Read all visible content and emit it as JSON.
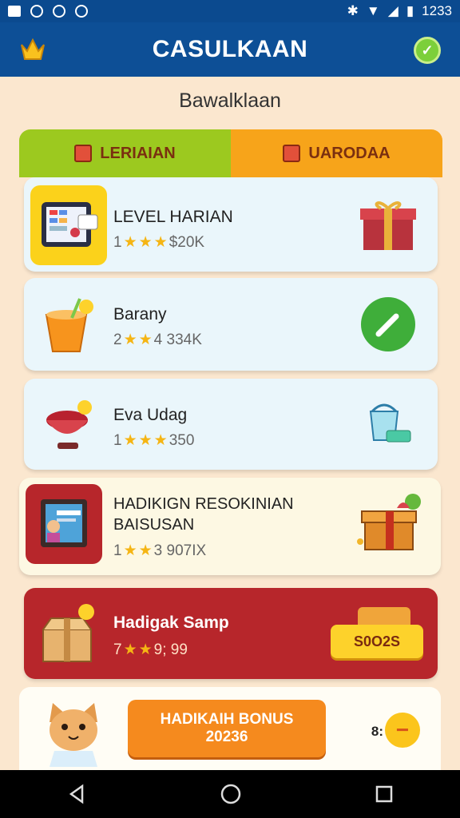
{
  "status_bar": {
    "time": "1233"
  },
  "app_bar": {
    "title": "CASULKAAN",
    "left_icon": "crown-icon",
    "right_icon": "check-badge-icon"
  },
  "subtitle": "Bawalklaan",
  "tabs": [
    {
      "label": "LERIAIAN",
      "icon": "gift-box-icon",
      "color": "#9cc91f"
    },
    {
      "label": "UARODAA",
      "icon": "basket-icon",
      "color": "#f7a41a"
    }
  ],
  "items": [
    {
      "name": "LEVEL HARIAN",
      "rank": "1",
      "stars": 3,
      "value": "$20K",
      "thumb_color": "#fbd21b",
      "thumb_icon": "tablet-icon",
      "right_icon": "gift-box-icon"
    },
    {
      "name": "Barany",
      "rank": "2",
      "stars": 2,
      "value": "4 334K",
      "thumb_color": "transparent",
      "thumb_icon": "juice-cup-icon",
      "right_icon": "pencil-badge-icon"
    },
    {
      "name": "Eva Udag",
      "rank": "1",
      "stars": 3,
      "value": "350",
      "thumb_color": "transparent",
      "thumb_icon": "bowl-icon",
      "right_icon": "cleaning-bucket-icon"
    },
    {
      "name_line1": "HADIKIGN RESOKINIAN",
      "name_line2": "BAISUSAN",
      "rank": "1",
      "stars": 2,
      "value": "3 907IX",
      "thumb_color": "#b7262b",
      "thumb_icon": "photo-card-icon",
      "right_icon": "treasure-box-icon"
    },
    {
      "name": "Hadigak Samp",
      "rank": "7",
      "stars": 2,
      "value": "9; 99",
      "thumb_icon": "parcel-icon",
      "button_label": "S0O2S"
    }
  ],
  "bonus": {
    "line1": "HADIKAIH BONUS",
    "line2": "20236",
    "count": "8:",
    "avatar_icon": "cat-avatar-icon",
    "minus_icon": "minus-icon"
  },
  "nav": {
    "back_icon": "back-icon",
    "home_icon": "home-icon",
    "recent_icon": "recent-apps-icon"
  }
}
